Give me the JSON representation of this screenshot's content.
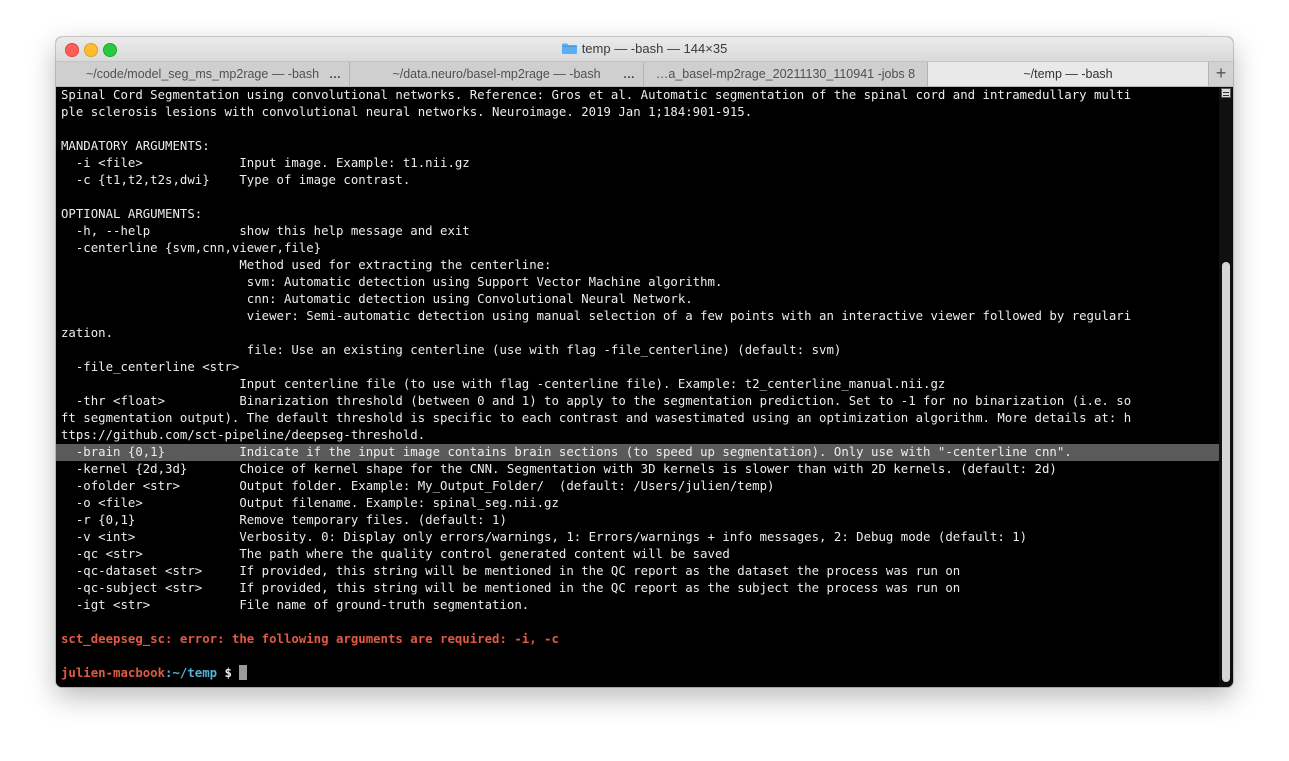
{
  "window": {
    "title": "temp — -bash — 144×35"
  },
  "tabs": [
    {
      "label": "~/code/model_seg_ms_mp2rage — -bash",
      "more": "…",
      "active": false
    },
    {
      "label": "~/data.neuro/basel-mp2rage — -bash",
      "more": "…",
      "active": false
    },
    {
      "label": "…a_basel-mp2rage_20211130_110941 -jobs 8",
      "more": "",
      "active": false
    },
    {
      "label": "~/temp — -bash",
      "more": "",
      "active": true
    }
  ],
  "tab_add": "+",
  "terminal": {
    "lines": [
      "Spinal Cord Segmentation using convolutional networks. Reference: Gros et al. Automatic segmentation of the spinal cord and intramedullary multi",
      "ple sclerosis lesions with convolutional neural networks. Neuroimage. 2019 Jan 1;184:901-915.",
      "",
      "MANDATORY ARGUMENTS:",
      "  -i <file>             Input image. Example: t1.nii.gz",
      "  -c {t1,t2,t2s,dwi}    Type of image contrast.",
      "",
      "OPTIONAL ARGUMENTS:",
      "  -h, --help            show this help message and exit",
      "  -centerline {svm,cnn,viewer,file}",
      "                        Method used for extracting the centerline:",
      "                         svm: Automatic detection using Support Vector Machine algorithm.",
      "                         cnn: Automatic detection using Convolutional Neural Network.",
      "                         viewer: Semi-automatic detection using manual selection of a few points with an interactive viewer followed by regulari",
      "zation.",
      "                         file: Use an existing centerline (use with flag -file_centerline) (default: svm)",
      "  -file_centerline <str>",
      "                        Input centerline file (to use with flag -centerline file). Example: t2_centerline_manual.nii.gz",
      "  -thr <float>          Binarization threshold (between 0 and 1) to apply to the segmentation prediction. Set to -1 for no binarization (i.e. so",
      "ft segmentation output). The default threshold is specific to each contrast and wasestimated using an optimization algorithm. More details at: h",
      "ttps://github.com/sct-pipeline/deepseg-threshold.",
      "  -brain {0,1}          Indicate if the input image contains brain sections (to speed up segmentation). Only use with \"-centerline cnn\".",
      "  -kernel {2d,3d}       Choice of kernel shape for the CNN. Segmentation with 3D kernels is slower than with 2D kernels. (default: 2d)",
      "  -ofolder <str>        Output folder. Example: My_Output_Folder/  (default: /Users/julien/temp)",
      "  -o <file>             Output filename. Example: spinal_seg.nii.gz",
      "  -r {0,1}              Remove temporary files. (default: 1)",
      "  -v <int>              Verbosity. 0: Display only errors/warnings, 1: Errors/warnings + info messages, 2: Debug mode (default: 1)",
      "  -qc <str>             The path where the quality control generated content will be saved",
      "  -qc-dataset <str>     If provided, this string will be mentioned in the QC report as the dataset the process was run on",
      "  -qc-subject <str>     If provided, this string will be mentioned in the QC report as the subject the process was run on",
      "  -igt <str>            File name of ground-truth segmentation.",
      ""
    ],
    "error": "sct_deepseg_sc: error: the following arguments are required: -i, -c",
    "prompt": {
      "host": "julien-macbook",
      "path": ":~/temp",
      "symbol": " $ "
    }
  }
}
